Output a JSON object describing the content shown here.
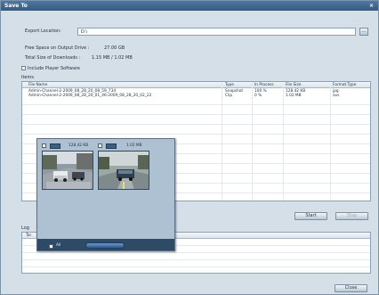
{
  "window": {
    "title": "Save To",
    "close_glyph": "×"
  },
  "export": {
    "label": "Export Location:",
    "value": "D:\\",
    "browse_label": "..."
  },
  "free_space": {
    "label": "Free Space on Output Drive :",
    "value": "27.00 GB"
  },
  "total_size": {
    "label": "Total Size of Downloads :",
    "value": "1.15 MB / 1.02 MB"
  },
  "include_player": {
    "label": "Include Player Software",
    "checked": false
  },
  "items": {
    "label": "Items",
    "columns": [
      "File Name",
      "Type",
      "In Process",
      "File Size",
      "Format Type"
    ],
    "rows": [
      [
        "Admin-Channel-2-2009_08_28_20_08_59_734",
        "Snapshot",
        "100 %",
        "128.42 KB",
        "jpg"
      ],
      [
        "Admin-Channel-2-2009_08_28_20_01_46-2009_08_28_20_02_22",
        "Clip",
        "0 %",
        "1.02 MB",
        "avs"
      ]
    ]
  },
  "buttons": {
    "start": "Start",
    "stop": "Stop",
    "close": "Close"
  },
  "log": {
    "label": "Log",
    "col_label": "Tar"
  },
  "overlay": {
    "thumb1_size": "128.42 KB",
    "thumb2_size": "1.02 MB",
    "select_all_label": "All"
  }
}
